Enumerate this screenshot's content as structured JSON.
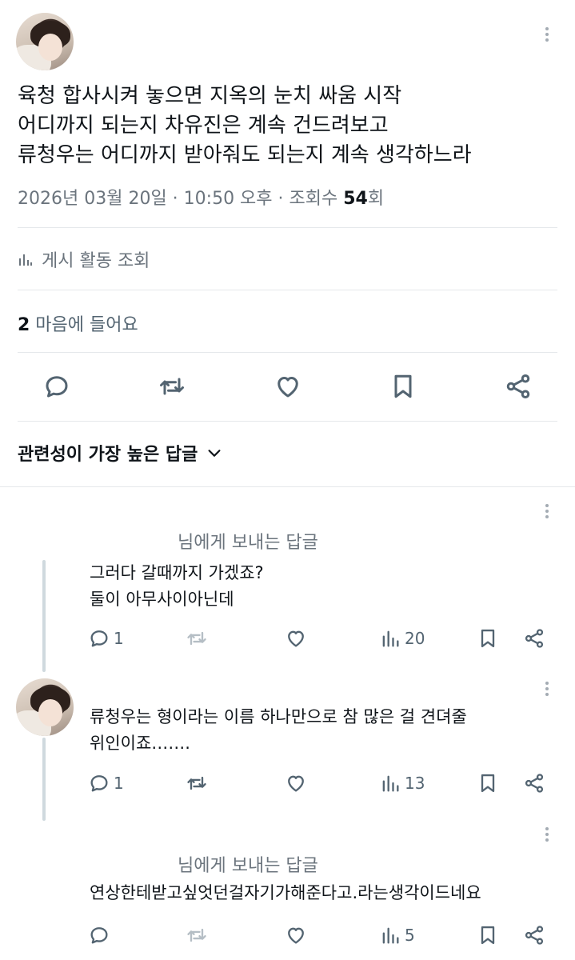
{
  "tweet": {
    "lines": [
      "육청 합사시켜 놓으면 지옥의 눈치 싸움 시작",
      "어디까지 되는지 차유진은 계속 건드려보고",
      "류청우는 어디까지 받아줘도 되는지 계속 생각하느라"
    ],
    "date": "2026년 03월 20일 · 10:50 오후 · 조회수 ",
    "views": "54",
    "views_suffix": "회",
    "activity_label": "게시 활동 조회",
    "likes_count": "2",
    "likes_label": " 마음에 들어요",
    "actions": [
      "reply-icon",
      "retweet-icon",
      "like-icon",
      "bookmark-icon",
      "share-icon"
    ]
  },
  "sort": {
    "label": "관련성이 가장 높은 답글"
  },
  "replies": [
    {
      "reply_to": "님에게 보내는 답글",
      "lines": [
        "그러다 갈때까지 가겠죠?",
        "둘이 아무사이아닌데"
      ],
      "reply_count": "1",
      "views": "20"
    },
    {
      "reply_to": "",
      "lines": [
        "류청우는 형이라는 이름 하나만으로 참 많은 걸 견뎌줄",
        "위인이죠……."
      ],
      "reply_count": "1",
      "views": "13"
    },
    {
      "reply_to": "님에게 보내는 답글",
      "lines": [
        "연상한테받고싶엇던걸자기가해준다고.라는생각이드네요"
      ],
      "reply_count": "",
      "views": "5"
    }
  ],
  "colors": {
    "text": "#0f1419",
    "secondary": "#6b747d",
    "divider": "#e5e8eb",
    "thread_line": "#cfd9de"
  }
}
